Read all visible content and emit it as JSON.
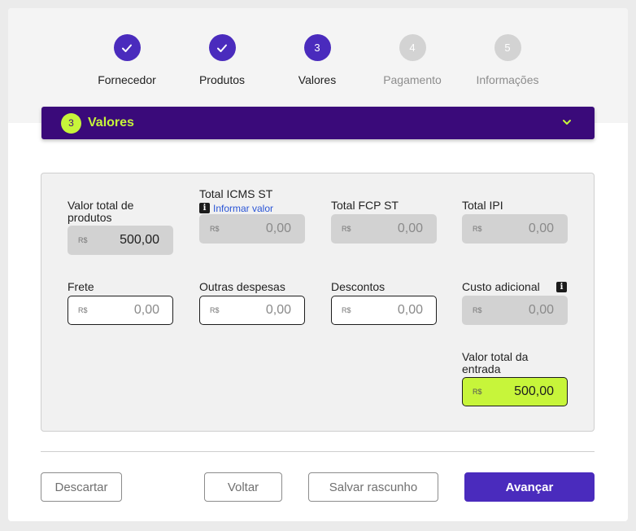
{
  "stepper": {
    "steps": [
      {
        "number": "1",
        "label": "Fornecedor",
        "state": "done"
      },
      {
        "number": "2",
        "label": "Produtos",
        "state": "done"
      },
      {
        "number": "3",
        "label": "Valores",
        "state": "active"
      },
      {
        "number": "4",
        "label": "Pagamento",
        "state": "todo"
      },
      {
        "number": "5",
        "label": "Informações",
        "state": "todo"
      }
    ]
  },
  "section": {
    "number": "3",
    "title": "Valores",
    "expand_icon": "chevron-down-icon"
  },
  "currency_symbol": "R$",
  "fields": {
    "valor_total_produtos": {
      "label": "Valor total de produtos",
      "value": "500,00"
    },
    "total_icms_st": {
      "label": "Total ICMS ST",
      "value": "0,00",
      "link": "Informar valor"
    },
    "total_fcp_st": {
      "label": "Total FCP ST",
      "value": "0,00"
    },
    "total_ipi": {
      "label": "Total IPI",
      "value": "0,00"
    },
    "frete": {
      "label": "Frete",
      "value": "0,00"
    },
    "outras_despesas": {
      "label": "Outras despesas",
      "value": "0,00"
    },
    "descontos": {
      "label": "Descontos",
      "value": "0,00"
    },
    "custo_adicional": {
      "label": "Custo adicional",
      "value": "0,00"
    },
    "valor_total_entrada": {
      "label": "Valor total da entrada",
      "value": "500,00"
    }
  },
  "actions": {
    "discard": "Descartar",
    "back": "Voltar",
    "save_draft": "Salvar rascunho",
    "next": "Avançar"
  },
  "colors": {
    "primary": "#4a2bbd",
    "section_bar": "#3a0a7a",
    "accent_lime": "#c7f53a",
    "link": "#2a55d6"
  }
}
